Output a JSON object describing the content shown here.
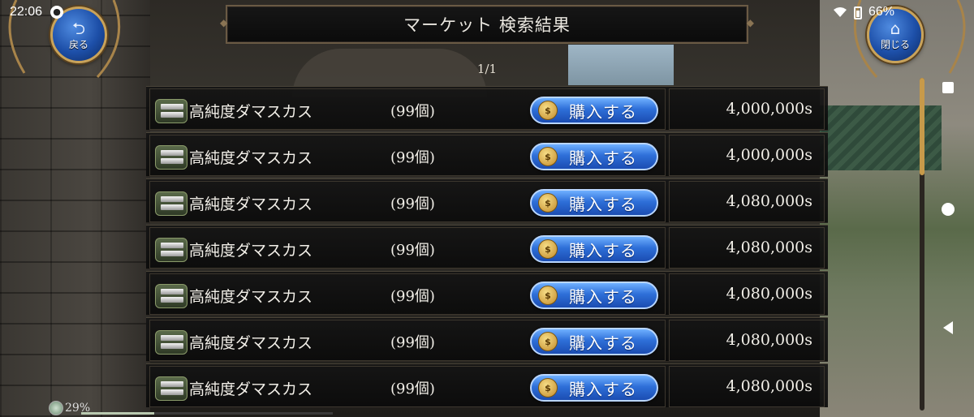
{
  "status_bar": {
    "time": "22:06",
    "battery": "66%"
  },
  "nav": {
    "back_label": "戻る",
    "close_label": "閉じる"
  },
  "header": {
    "title": "マーケット  検索結果",
    "page": "1/1"
  },
  "listing": {
    "buy_label": "購入する",
    "rows": [
      {
        "name": "高純度ダマスカス",
        "qty": "(99個)",
        "price": "4,000,000s"
      },
      {
        "name": "高純度ダマスカス",
        "qty": "(99個)",
        "price": "4,000,000s"
      },
      {
        "name": "高純度ダマスカス",
        "qty": "(99個)",
        "price": "4,080,000s"
      },
      {
        "name": "高純度ダマスカス",
        "qty": "(99個)",
        "price": "4,080,000s"
      },
      {
        "name": "高純度ダマスカス",
        "qty": "(99個)",
        "price": "4,080,000s"
      },
      {
        "name": "高純度ダマスカス",
        "qty": "(99個)",
        "price": "4,080,000s"
      },
      {
        "name": "高純度ダマスカス",
        "qty": "(99個)",
        "price": "4,080,000s"
      }
    ]
  },
  "footer": {
    "progress_text": "29%",
    "progress_fraction": 0.29
  },
  "colors": {
    "button_blue": "#2e6fd8",
    "gold_border": "#c9a35a",
    "scroll_thumb": "#c79a4a"
  }
}
